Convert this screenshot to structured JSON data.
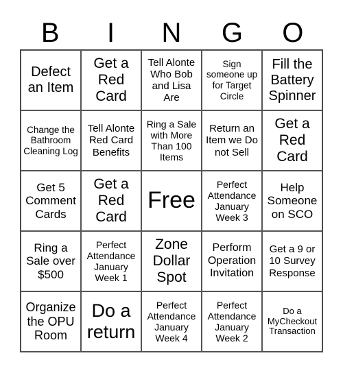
{
  "header": [
    "B",
    "I",
    "N",
    "G",
    "O"
  ],
  "cells": [
    {
      "text": "Defect an Item",
      "size": 20
    },
    {
      "text": "Get a Red Card",
      "size": 21
    },
    {
      "text": "Tell Alonte Who Bob and Lisa Are",
      "size": 15
    },
    {
      "text": "Sign someone up for Target Circle",
      "size": 13.5
    },
    {
      "text": "Fill the Battery Spinner",
      "size": 20
    },
    {
      "text": "Change the Bathroom Cleaning Log",
      "size": 13.5
    },
    {
      "text": "Tell Alonte Red Card Benefits",
      "size": 15
    },
    {
      "text": "Ring a Sale with More Than 100 Items",
      "size": 14
    },
    {
      "text": "Return an Item we Do not Sell",
      "size": 15
    },
    {
      "text": "Get a Red Card",
      "size": 21
    },
    {
      "text": "Get 5 Comment Cards",
      "size": 17
    },
    {
      "text": "Get a Red Card",
      "size": 21
    },
    {
      "text": "Free",
      "size": 34
    },
    {
      "text": "Perfect Attendance January Week 3",
      "size": 14
    },
    {
      "text": "Help Someone on SCO",
      "size": 17
    },
    {
      "text": "Ring a Sale over $500",
      "size": 17
    },
    {
      "text": "Perfect Attendance January Week 1",
      "size": 14
    },
    {
      "text": "Zone Dollar Spot",
      "size": 21
    },
    {
      "text": "Perform Operation Invitation",
      "size": 16
    },
    {
      "text": "Get a 9 or 10 Survey Response",
      "size": 15
    },
    {
      "text": "Organize the OPU Room",
      "size": 18
    },
    {
      "text": "Do a return",
      "size": 27
    },
    {
      "text": "Perfect Attendance January Week 4",
      "size": 14
    },
    {
      "text": "Perfect Attendance January Week 2",
      "size": 14
    },
    {
      "text": "Do a MyCheckout Transaction",
      "size": 13
    }
  ]
}
